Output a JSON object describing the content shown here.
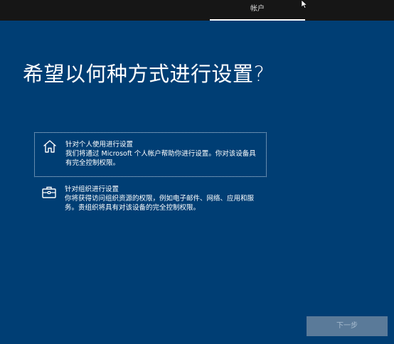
{
  "header": {
    "tab_label": "帐户"
  },
  "page": {
    "title": "希望以何种方式进行设置?"
  },
  "options": [
    {
      "icon": "home-icon",
      "title": "针对个人使用进行设置",
      "description": "我们将通过 Microsoft 个人帐户帮助你进行设置。你对该设备具有完全控制权限。",
      "selected": true
    },
    {
      "icon": "briefcase-icon",
      "title": "针对组织进行设置",
      "description": "你将获得访问组织资源的权限，例如电子邮件、网络、应用和服务。贵组织将具有对该设备的完全控制权限。",
      "selected": false
    }
  ],
  "footer": {
    "next_label": "下一步"
  },
  "colors": {
    "background": "#003e74",
    "topbar": "#161616",
    "button_disabled": "#5a7a99"
  }
}
